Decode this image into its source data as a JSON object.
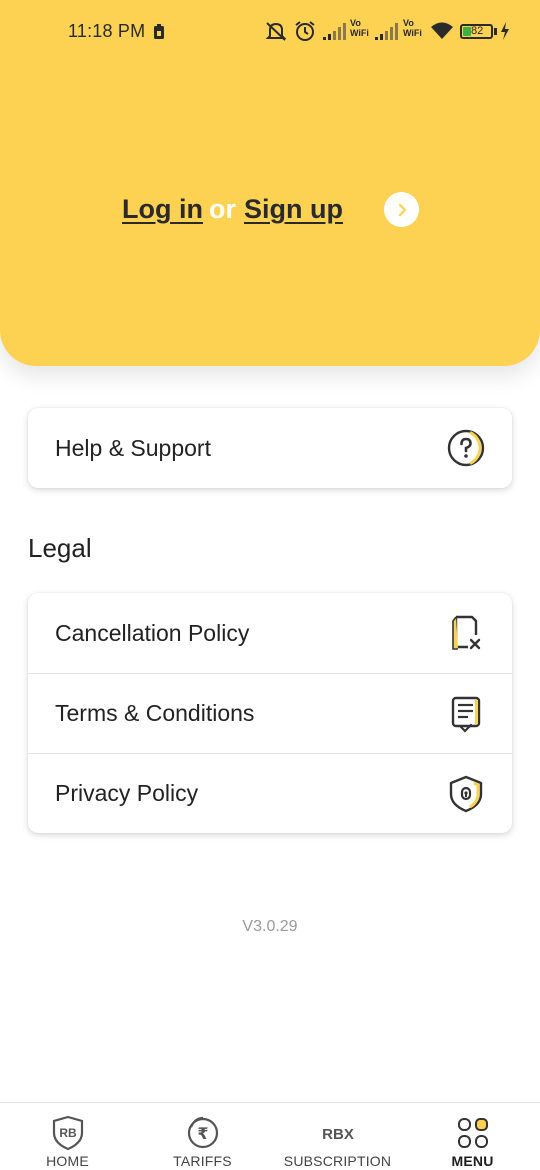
{
  "status_bar": {
    "time": "11:18 PM",
    "battery": "82",
    "icons": [
      "sim-icon",
      "mute-icon",
      "alarm-icon",
      "signal-icon",
      "vowifi-icon",
      "signal-icon",
      "vowifi-icon",
      "wifi-icon",
      "battery-icon",
      "charging-icon"
    ],
    "vowifi_top": "Vo",
    "vowifi_bottom": "WiFi"
  },
  "header": {
    "login_label": "Log in",
    "or_label": "or",
    "signup_label": "Sign up",
    "arrow_icon": "chevron-right-icon",
    "background_color": "#fdd152"
  },
  "help": {
    "label": "Help & Support",
    "icon": "question-circle-icon"
  },
  "legal": {
    "title": "Legal",
    "items": [
      {
        "label": "Cancellation Policy",
        "icon": "document-cancel-icon"
      },
      {
        "label": "Terms & Conditions",
        "icon": "document-checklist-icon"
      },
      {
        "label": "Privacy Policy",
        "icon": "shield-lock-icon"
      }
    ]
  },
  "version": "V3.0.29",
  "nav": {
    "items": [
      {
        "label": "HOME",
        "icon": "rb-shield-icon",
        "active": false
      },
      {
        "label": "TARIFFS",
        "icon": "rupee-icon",
        "active": false
      },
      {
        "label": "SUBSCRIPTION",
        "icon": "rbx-icon",
        "active": false,
        "icon_text": "RBX"
      },
      {
        "label": "MENU",
        "icon": "menu-grid-icon",
        "active": true
      }
    ],
    "home_icon_text": "RB",
    "tariffs_icon_text": "₹",
    "accent_color": "#fdd152"
  }
}
